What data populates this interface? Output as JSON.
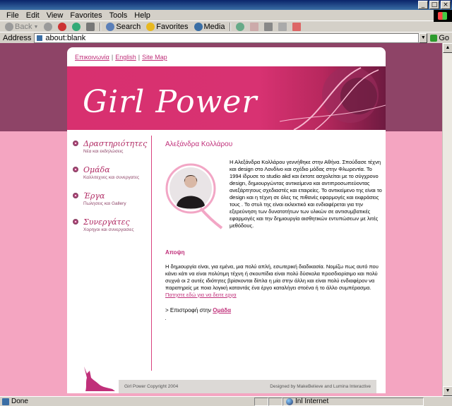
{
  "browser": {
    "menu": [
      "File",
      "Edit",
      "View",
      "Favorites",
      "Tools",
      "Help"
    ],
    "toolbar": {
      "back": "Back",
      "search": "Search",
      "favorites": "Favorites",
      "media": "Media"
    },
    "address": {
      "label": "Address",
      "value": "about:blank",
      "go": "Go"
    },
    "status": {
      "text": "Done",
      "zone": "Inl Internet"
    }
  },
  "site": {
    "top_links": [
      "Επικοινωνία",
      "English",
      "Site Map"
    ],
    "banner_title": "Girl Power",
    "nav": [
      {
        "title": "Δραστηριότητες",
        "sub": "Νέα και εκδηλώσεις"
      },
      {
        "title": "Ομάδα",
        "sub": "Καλλιτεχνες και συνεργατες"
      },
      {
        "title": "Έργα",
        "sub": "Πωλησεις και Gallery"
      },
      {
        "title": "Συνεργάτες",
        "sub": "Χορηγοι και συνεργασιες"
      }
    ],
    "content": {
      "title": "Αλεξάνδρα Κολλάρου",
      "bio": "Η Αλεξάνδρα Κολλάρου γεννήθηκε στην Αθήνα. Σπούδασε τέχνη και design στο Λονδίνο και σχέδιο μόδας στην Φλωρεντία. Το 1994 ίδρυσε το studio akd και έκτοτε ασχολείται με το σύγχρονο design, δημιουργώντας αντικείμενα και αντιπροσωπεύοντας ανεξάρτητους σχεδιαστές και εταιρείες. Το αντικείμενο της είναι το design και η τέχνη σε όλες τις πιθανές εφαρμογές και εκφράσεις τους . Το στυλ της είναι εκλεκτικό και ενδιαφέρεται για την εξερεύνηση των δυνατοτήτων των υλικών σε αντισυμβατικές εφαρμογές και την δημιουργία αισθητικών εντυπώσεων με λιτές μεθόδους.",
      "opinion_heading": "Αποψη",
      "opinion": "Η δημιουργία είναι, για εμένα, μια πολύ απλή, εσωτερική διαδικασία. Νομίζω πως αυτό που κάνει κάτι να είναι πολύτιμη τέχνη ή σκουπίδια είναι πολύ δύσκολα προσδιορίσιμο και πολύ συχνά οι 2 αυτές ιδιότητες βρίσκονται δίπλα η μία στην άλλη και είναι πολύ ενδιαφέρον να παρατηρείς με ποια λογική καταντάς ένα έργο καταλήγει στοένα ή το άλλο συμπέρασμα.",
      "opinion_link": "Πατηστε εδώ για να δειτε εργα",
      "back_prefix": "> Επιστροφή στην",
      "back_link": "Ομάδα"
    },
    "footer": {
      "left": "Girl Power Copyright 2004",
      "right": "Designed by MakeBelieve and Lumina Interactive"
    }
  },
  "colors": {
    "accent": "#c0307a",
    "banner": "#d8306f",
    "band": "#8e4467",
    "page_bg": "#f4a5c1"
  }
}
